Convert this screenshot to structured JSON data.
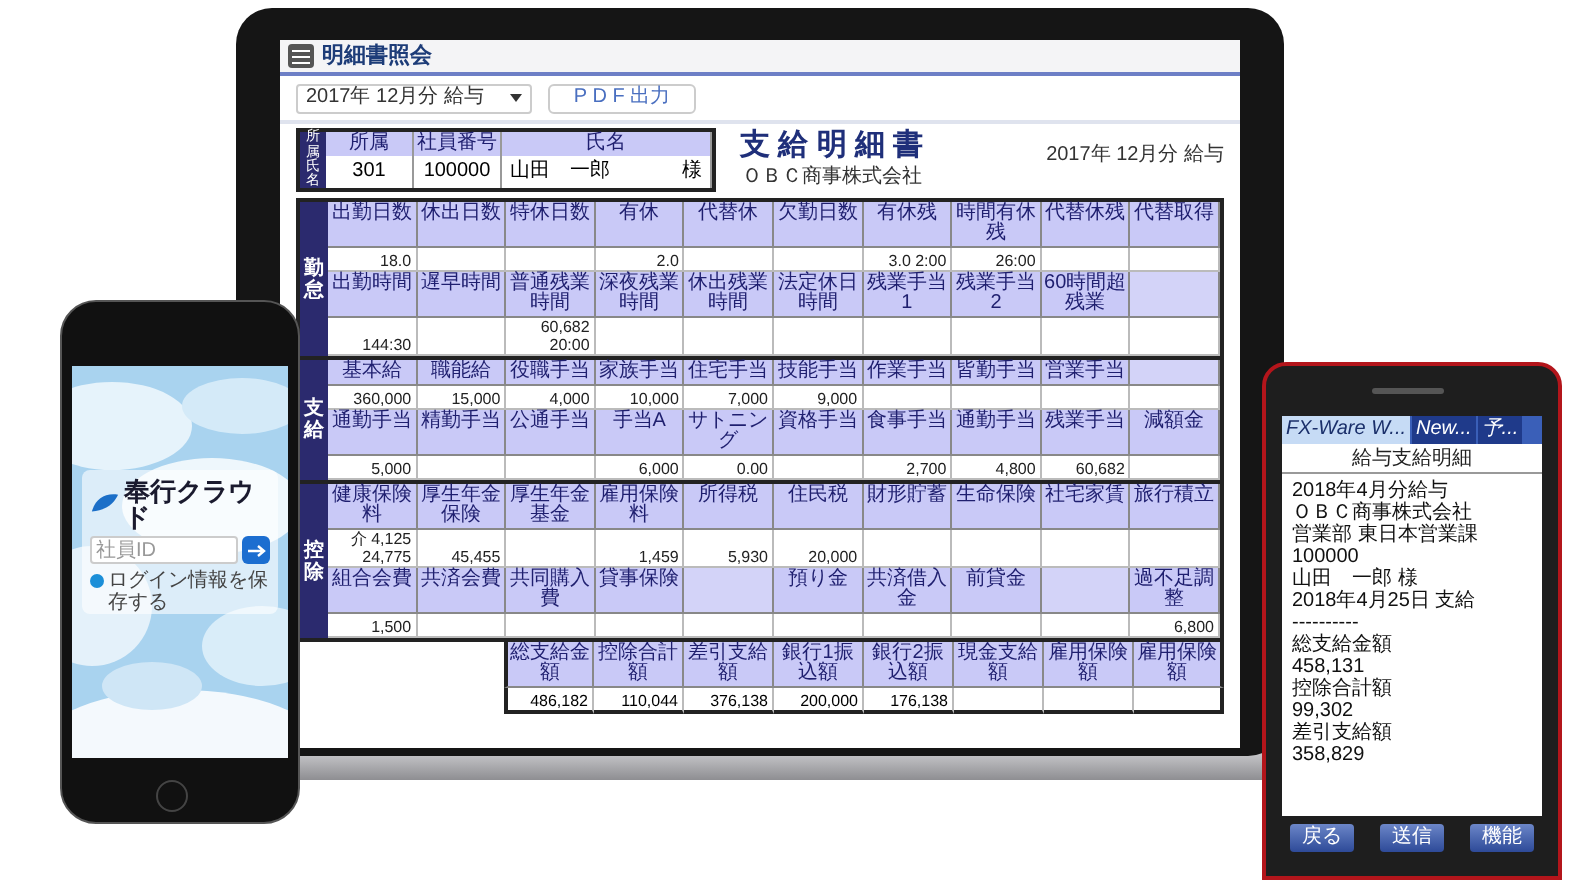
{
  "laptop_app": {
    "title": "明細書照会",
    "period_select": {
      "value": "2017年 12月分 給与"
    },
    "pdf_button": "P D F 出力",
    "employee_header": {
      "side_label": "所属氏名",
      "columns": [
        "所属",
        "社員番号",
        "氏名"
      ],
      "values": [
        "301",
        "100000",
        "山田　一郎"
      ],
      "honorific": "様"
    },
    "document_title": "支 給 明 細 書",
    "company": "ＯＢＣ商事株式会社",
    "period": "2017年 12月分 給与",
    "sections": [
      {
        "label": "勤怠",
        "rows": [
          [
            {
              "header": "出勤日数",
              "value": "18.0"
            },
            {
              "header": "休出日数"
            },
            {
              "header": "特休日数"
            },
            {
              "header": "有休",
              "value": "2.0"
            },
            {
              "header": "代替休"
            },
            {
              "header": "欠勤日数"
            },
            {
              "header": "有休残",
              "value": "3.0 2:00"
            },
            {
              "header": "時間有休残",
              "value": "26:00"
            },
            {
              "header": "代替休残"
            },
            {
              "header": "代替取得"
            }
          ],
          [
            {
              "header": "出勤時間",
              "value": "144:30"
            },
            {
              "header": "遅早時間"
            },
            {
              "header": "普通残業時間",
              "value": "60,682\n20:00"
            },
            {
              "header": "深夜残業時間"
            },
            {
              "header": "休出残業時間"
            },
            {
              "header": "法定休日時間"
            },
            {
              "header": "残業手当1"
            },
            {
              "header": "残業手当2"
            },
            {
              "header": "60時間超残業"
            },
            {
              "kind": "blank"
            }
          ]
        ]
      },
      {
        "label": "支給",
        "rows": [
          [
            {
              "header": "基本給",
              "value": "360,000"
            },
            {
              "header": "職能給",
              "value": "15,000"
            },
            {
              "header": "役職手当",
              "value": "4,000"
            },
            {
              "header": "家族手当",
              "value": "10,000"
            },
            {
              "header": "住宅手当",
              "value": "7,000"
            },
            {
              "header": "技能手当",
              "value": "9,000"
            },
            {
              "header": "作業手当"
            },
            {
              "header": "皆勤手当"
            },
            {
              "header": "営業手当"
            },
            {
              "kind": "blank"
            }
          ],
          [
            {
              "header": "通勤手当",
              "value": "5,000"
            },
            {
              "header": "精勤手当"
            },
            {
              "header": "公通手当"
            },
            {
              "header": "手当A",
              "value": "6,000"
            },
            {
              "header": "サトニング",
              "value": "0.00"
            },
            {
              "header": "資格手当"
            },
            {
              "header": "食事手当",
              "value": "2,700"
            },
            {
              "header": "通勤手当",
              "value": "4,800"
            },
            {
              "header": "残業手当",
              "value": "60,682"
            },
            {
              "header": "減額金"
            }
          ]
        ]
      },
      {
        "label": "控除",
        "rows": [
          [
            {
              "header": "健康保険料",
              "value": "介 4,125\n24,775"
            },
            {
              "header": "厚生年金保険",
              "value": "45,455"
            },
            {
              "header": "厚生年金基金"
            },
            {
              "header": "雇用保険料",
              "value": "1,459"
            },
            {
              "header": "所得税",
              "value": "5,930"
            },
            {
              "header": "住民税",
              "value": "20,000"
            },
            {
              "header": "財形貯蓄"
            },
            {
              "header": "生命保険"
            },
            {
              "header": "社宅家賃"
            },
            {
              "header": "旅行積立"
            }
          ],
          [
            {
              "header": "組合会費",
              "value": "1,500"
            },
            {
              "header": "共済会費"
            },
            {
              "header": "共同購入費"
            },
            {
              "header": "貸事保険"
            },
            {
              "kind": "blank"
            },
            {
              "header": "預り金"
            },
            {
              "header": "共済借入金"
            },
            {
              "header": "前貸金"
            },
            {
              "kind": "blank"
            },
            {
              "header": "過不足調整",
              "value": "6,800"
            }
          ]
        ]
      }
    ],
    "totals": [
      {
        "header": "総支給金額",
        "value": "486,182"
      },
      {
        "header": "控除合計額",
        "value": "110,044"
      },
      {
        "header": "差引支給額",
        "value": "376,138"
      },
      {
        "header": "銀行1振込額",
        "value": "200,000"
      },
      {
        "header": "銀行2振込額",
        "value": "176,138"
      },
      {
        "header": "現金支給額"
      },
      {
        "header": "雇用保険額"
      },
      {
        "header": "雇用保険額"
      }
    ]
  },
  "left_phone": {
    "logo": "奉行クラウド",
    "login_field": {
      "placeholder": "社員ID"
    },
    "remember": {
      "label": "ログイン情報を保存する",
      "checked": true
    }
  },
  "right_phone": {
    "tabs": [
      {
        "label": "FX-Ware W...",
        "selected": true
      },
      {
        "label": "New...",
        "selected": false
      },
      {
        "label": "予...",
        "selected": false
      }
    ],
    "title": "給与支給明細",
    "lines": [
      "2018年4月分給与",
      "ＯＢＣ商事株式会社",
      "営業部 東日本営業課",
      "100000",
      "山田　一郎 様",
      "2018年4月25日 支給",
      "----------",
      "総支給金額",
      "458,131",
      "控除合計額",
      "99,302",
      "差引支給額",
      "358,829"
    ],
    "buttons": [
      "戻る",
      "送信",
      "機能"
    ]
  }
}
